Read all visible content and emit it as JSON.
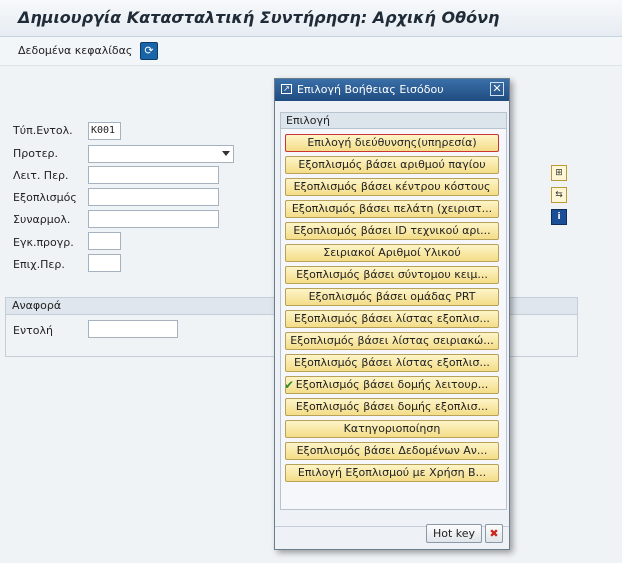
{
  "window": {
    "title": "Δημιουργία Κατασταλτική Συντήρηση: Αρχική Οθόνη"
  },
  "toolbar": {
    "header_data_label": "Δεδομένα κεφαλίδας",
    "refresh_icon": "refresh-icon"
  },
  "form": {
    "order_type_label": "Τύπ.Εντολ.",
    "order_type_value": "K001",
    "priority_label": "Προτερ.",
    "func_loc_label": "Λειτ. Περ.",
    "equipment_label": "Εξοπλισμός",
    "assembly_label": "Συναρμολ.",
    "planning_label": "Εγκ.προγρ.",
    "planner_group_label": "Επιχ.Περ."
  },
  "reference": {
    "group_title": "Αναφορά",
    "order_label": "Εντολή"
  },
  "dialog": {
    "title": "Επιλογή Βοήθειας Εισόδου",
    "group_title": "Επιλογή",
    "options": [
      "Επιλογή διεύθυνσης(υπηρεσία)",
      "Εξοπλισμός βάσει αριθμού παγίου",
      "Εξοπλισμός βάσει κέντρου κόστους",
      "Εξοπλισμός βάσει πελάτη (χειριστ...",
      "Εξοπλισμός βάσει ID τεχνικού αρι...",
      "Σειριακοί Αριθμοί Υλικού",
      "Εξοπλισμός βάσει σύντομου κειμ...",
      "Εξοπλισμός βάσει ομάδας PRT",
      "Εξοπλισμός βάσει λίστας εξοπλισ...",
      "Εξοπλισμός βάσει λίστας σειριακώ...",
      "Εξοπλισμός βάσει λίστας εξοπλισ...",
      "Εξοπλισμός βάσει δομής λειτουρ...",
      "Εξοπλισμός βάσει δομής εξοπλισ...",
      "Κατηγοριοποίηση",
      "Εξοπλισμός βάσει Δεδομένων Αν...",
      "Επιλογή Εξοπλισμού με Χρήση Β..."
    ],
    "selected_index": 0,
    "checked_index": 11,
    "hotkey_label": "Hot key"
  },
  "colors": {
    "option_fill": "#f4dd88",
    "title_blue": "#1f4c80",
    "check_green": "#2e8b2e"
  }
}
